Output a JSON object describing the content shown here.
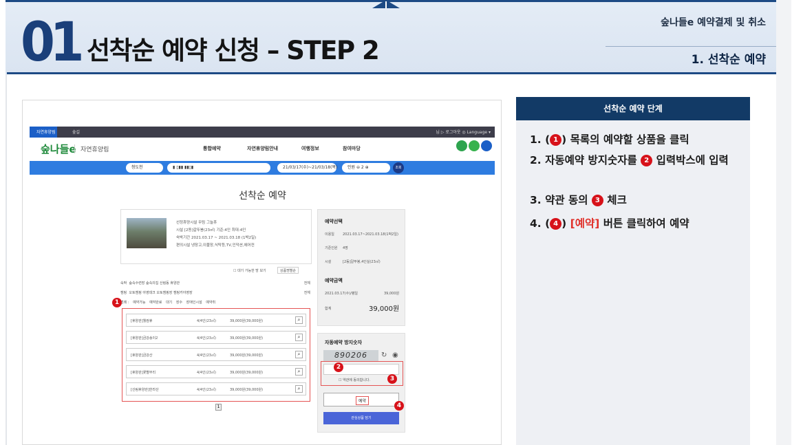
{
  "header": {
    "number": "01",
    "title": "선착순 예약 신청 – STEP 2",
    "category": "숲나들e 예약결제 및 취소",
    "section": "1. 선착순 예약"
  },
  "screenshot": {
    "topbar": {
      "active_tab": "자연휴양림",
      "tab2": "숲길",
      "right": "님 ▷ 로그아웃 ◎ Language ▾"
    },
    "logo": "숲나들e",
    "logo_sub": "자연휴양림",
    "nav": [
      "통합예약",
      "자연휴양림안내",
      "여행정보",
      "참여마당"
    ],
    "search": {
      "location": "청도천",
      "date_range": "21/03/17(수)~21/03/18(목)",
      "people_label": "인원",
      "people_count": "2",
      "search_button": "조회"
    },
    "page_title": "선착순 예약",
    "product": {
      "lines": [
        "선정휴양시설   무림 그늘휴",
        "시설      [2동]갈뚜봉(23㎡) 기준:4인 최대:4인",
        "숙박기간    2021.03.17 ~ 2021.03.18 (1박2일)",
        "편의시설    냉장고,이불장,식탁등,TV,인덕션,에어컨"
      ]
    },
    "filters": {
      "available_only": "대기 가능한 방 보기",
      "sort": "상품명별순",
      "row1_label": "숙박",
      "row1_items": "숲속수련장 숲속의집 산림동 휴양관",
      "row1_all": "전체",
      "row2_label": "캠핑",
      "row2_items": "오토캠핑 야영데크 오토캠핑장 캠핑카야영장",
      "row2_all": "전체",
      "legend_label": "범례 :",
      "legend_items": [
        "예약가능",
        "예약완료",
        "대기",
        "장수",
        "장애인시설",
        "예약취"
      ]
    },
    "rows": [
      {
        "name": "[휴양관]웰컴휴",
        "cap": "4/4인(23㎡)",
        "price": "39,000원(39,000원)"
      },
      {
        "name": "[휴양관]금강송이2",
        "cap": "4/4인(23㎡)",
        "price": "39,000원(39,000원)"
      },
      {
        "name": "[휴양관]금강산",
        "cap": "4/4인(23㎡)",
        "price": "39,000원(39,000원)"
      },
      {
        "name": "[휴양관]꽃별무리",
        "cap": "4/4인(23㎡)",
        "price": "39,000원(39,000원)"
      },
      {
        "name": "[산림휴양관]한라산",
        "cap": "4/4인(23㎡)",
        "price": "39,000원(39,000원)"
      }
    ],
    "pager": "1",
    "selection": {
      "title": "예약선택",
      "date_label": "이용일",
      "date": "2021.03.17~2021.03.18(1박2일)",
      "people_label": "기준인원",
      "people": "4명",
      "facility_label": "시설",
      "facility": "[2동]갈뚜봉,4인실(23㎡)"
    },
    "payment": {
      "title": "예약금액",
      "line_label": "2021.03.17(수)/평일",
      "line_value": "39,000원",
      "total_label": "합계",
      "total_value": "39,000원"
    },
    "captcha": {
      "title": "자동예약 방지숫자",
      "value": "890206",
      "agree": "약관에 동의합니다."
    },
    "reserve_button": "예약",
    "favorite_button": "관심상품 담기",
    "badges": [
      "1",
      "2",
      "3",
      "4"
    ]
  },
  "steps": {
    "title": "선착순 예약 단계",
    "items": [
      {
        "prefix": "1. (",
        "badge": "1",
        "text": ") 목록의 예약할 상품을 클릭"
      },
      {
        "prefix": "2. 자동예약 방지숫자를 ",
        "badge": "2",
        "text": " 입력박스에 입력"
      },
      {
        "prefix": "3. 약관 동의 ",
        "badge": "3",
        "text": " 체크"
      },
      {
        "prefix": "4. (",
        "badge": "4",
        "red": "[예약]",
        "text": " 버튼 클릭하여 예약"
      }
    ]
  }
}
